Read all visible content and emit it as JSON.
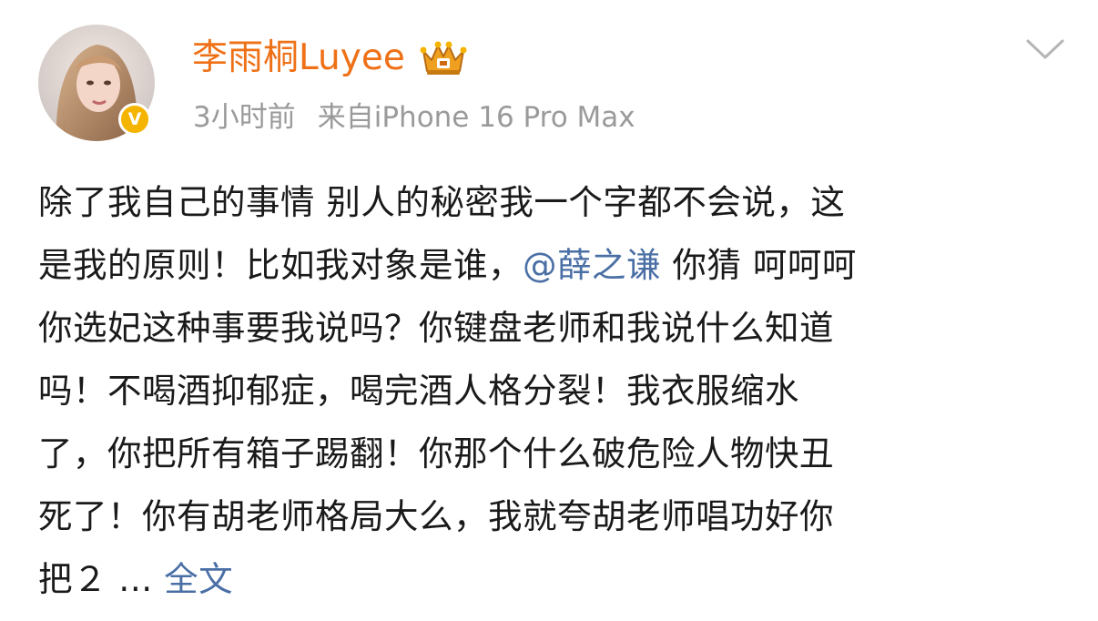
{
  "author": {
    "name": "李雨桐Luyee",
    "verified_badge": "V",
    "vip_icon": "crown-icon"
  },
  "meta": {
    "time": "3小时前",
    "source": "来自iPhone 16 Pro Max"
  },
  "more_icon": "chevron-down-icon",
  "post": {
    "lines": [
      {
        "text": "除了我自己的事情 别人的秘密我一个字都不会说，这"
      },
      {
        "before": "是我的原则！比如我对象是谁，",
        "mention": "@薛之谦",
        "after": " 你猜 呵呵呵"
      },
      {
        "text": "你选妃这种事要我说吗？你键盘老师和我说什么知道"
      },
      {
        "text": "吗！不喝酒抑郁症，喝完酒人格分裂！我衣服缩水"
      },
      {
        "text": "了，你把所有箱子踢翻！你那个什么破危险人物快丑"
      },
      {
        "text": "死了！你有胡老师格局大么，我就夸胡老师唱功好你"
      },
      {
        "before": "把２ ... ",
        "link": "全文"
      }
    ]
  },
  "colors": {
    "name": "#ef7117",
    "link": "#4a6fa5",
    "meta": "#9a9a9a",
    "body": "#1a1a1a",
    "badge": "#f5b400"
  }
}
